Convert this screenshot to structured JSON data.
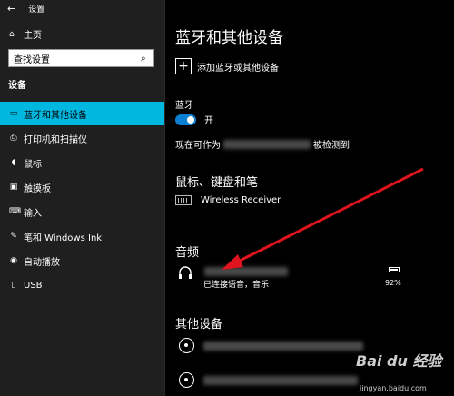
{
  "window": {
    "back_icon": "back-arrow-icon",
    "title": "设置"
  },
  "sidebar": {
    "home_label": "主页",
    "search": {
      "value": "查找设置"
    },
    "section_label": "设备",
    "items": [
      {
        "label": "蓝牙和其他设备",
        "icon": "bluetooth-devices-icon",
        "active": true
      },
      {
        "label": "打印机和扫描仪",
        "icon": "printer-icon",
        "active": false
      },
      {
        "label": "鼠标",
        "icon": "mouse-icon",
        "active": false
      },
      {
        "label": "触摸板",
        "icon": "touchpad-icon",
        "active": false
      },
      {
        "label": "输入",
        "icon": "keyboard-icon",
        "active": false
      },
      {
        "label": "笔和 Windows Ink",
        "icon": "pen-icon",
        "active": false
      },
      {
        "label": "自动播放",
        "icon": "autoplay-icon",
        "active": false
      },
      {
        "label": "USB",
        "icon": "usb-icon",
        "active": false
      }
    ]
  },
  "main": {
    "title": "蓝牙和其他设备",
    "add_device_label": "添加蓝牙或其他设备",
    "bluetooth_label": "蓝牙",
    "bluetooth_toggle_state": "开",
    "discoverable_prefix": "现在可作为",
    "discoverable_suffix": "被检测到",
    "mouse_section_title": "鼠标、键盘和笔",
    "mouse_devices": [
      {
        "name": "Wireless Receiver",
        "icon": "keyboard-icon"
      }
    ],
    "audio_section_title": "音频",
    "audio_device": {
      "status": "已连接语音，音乐",
      "battery": "92%",
      "icon": "headset-icon"
    },
    "other_section_title": "其他设备"
  },
  "watermark": {
    "brand": "Bai du 经验",
    "url": "jingyan.baidu.com"
  },
  "colors": {
    "accent": "#00b7e0",
    "toggle": "#0a7fd4",
    "arrow": "#e0141e"
  }
}
